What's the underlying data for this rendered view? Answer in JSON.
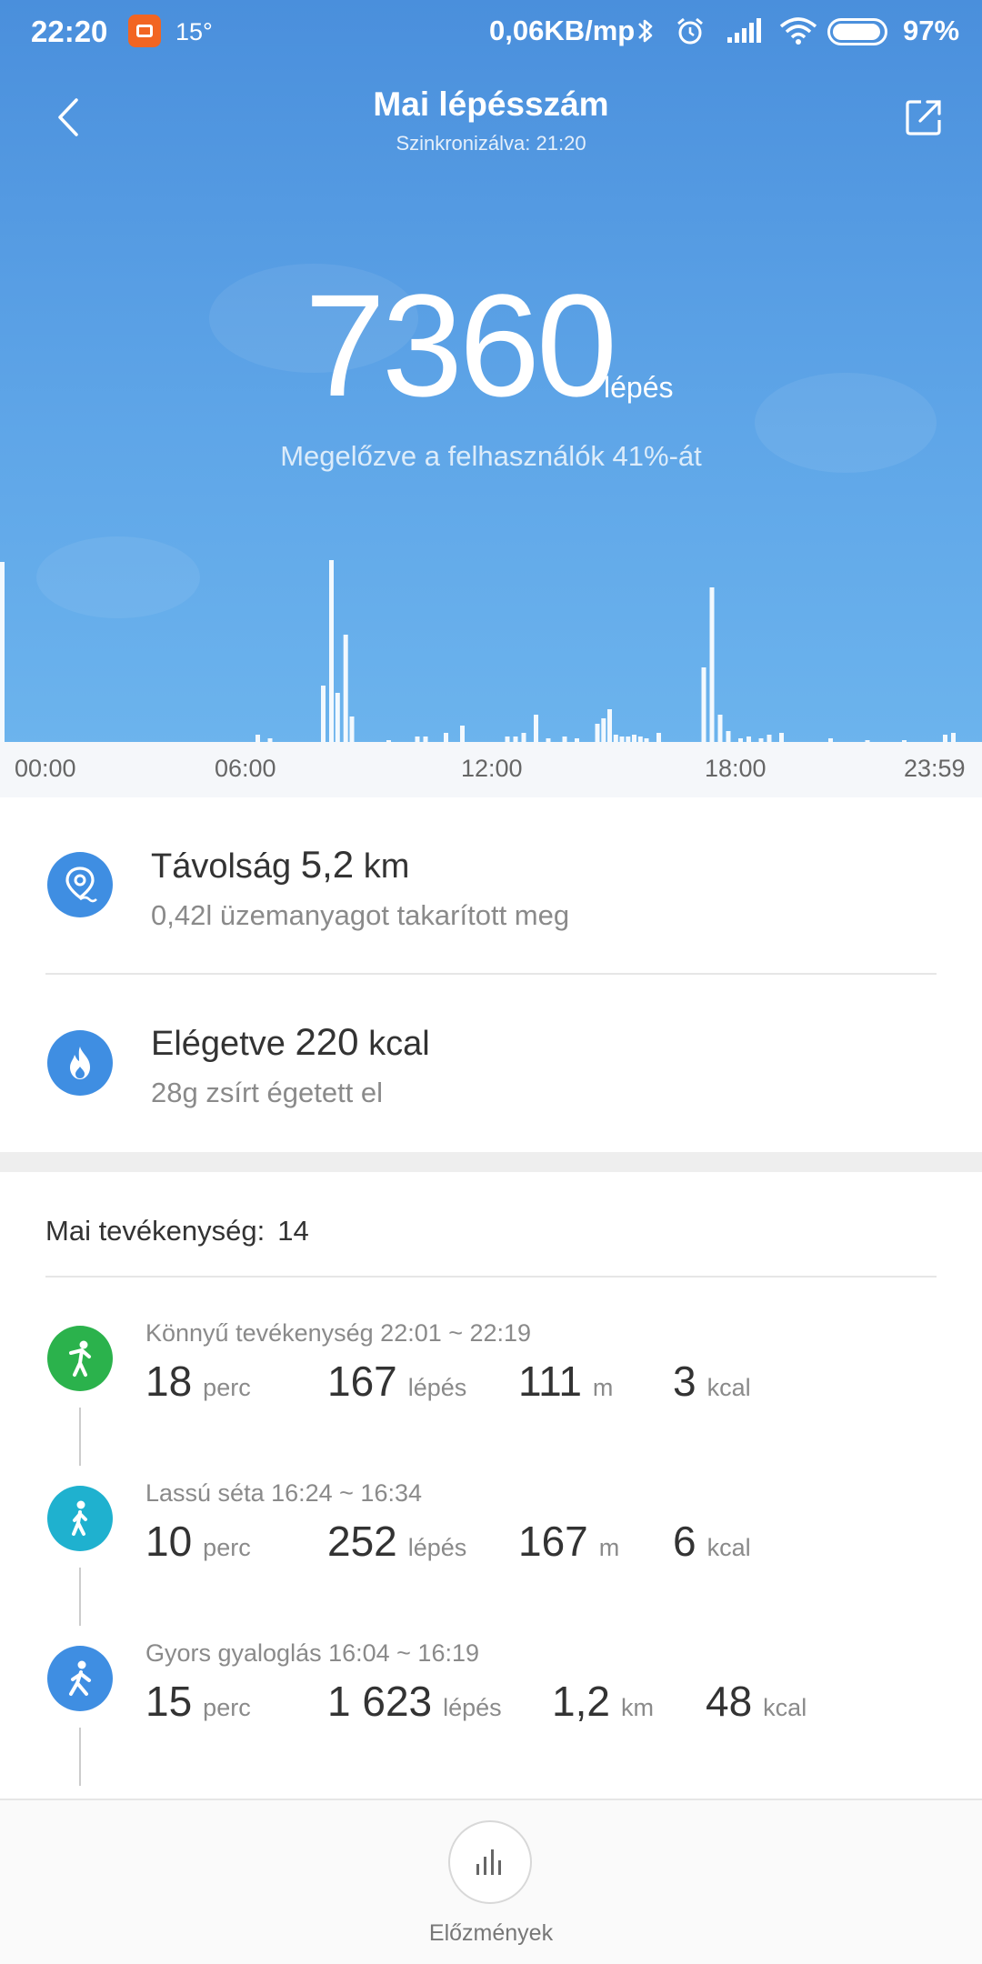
{
  "status_bar": {
    "time": "22:20",
    "temperature": "15°",
    "network_speed": "0,06KB/mp",
    "battery_percent": "97%",
    "icons": [
      "app-notification-icon",
      "bluetooth-icon",
      "alarm-icon",
      "signal-icon",
      "wifi-icon",
      "battery-icon"
    ]
  },
  "header": {
    "title": "Mai lépésszám",
    "subtitle": "Szinkronizálva: 21:20",
    "back_icon": "back-arrow-icon",
    "share_icon": "share-icon"
  },
  "steps": {
    "count": "7360",
    "unit": "lépés",
    "comparison": "Megelőzve a felhasználók 41%-át"
  },
  "chart_data": {
    "type": "bar",
    "title": "",
    "xlabel": "",
    "ylabel": "",
    "x_tick_labels": [
      "00:00",
      "06:00",
      "12:00",
      "18:00",
      "23:59"
    ],
    "x_range_hours": [
      0,
      24
    ],
    "grid": false,
    "bar_color": "#ffffff",
    "values_relative": [
      {
        "hour": 0.05,
        "value": 0.99
      },
      {
        "hour": 6.3,
        "value": 0.04
      },
      {
        "hour": 6.6,
        "value": 0.02
      },
      {
        "hour": 7.9,
        "value": 0.31
      },
      {
        "hour": 8.1,
        "value": 1.0
      },
      {
        "hour": 8.25,
        "value": 0.27
      },
      {
        "hour": 8.45,
        "value": 0.59
      },
      {
        "hour": 8.6,
        "value": 0.14
      },
      {
        "hour": 9.5,
        "value": 0.01
      },
      {
        "hour": 10.2,
        "value": 0.03
      },
      {
        "hour": 10.4,
        "value": 0.03
      },
      {
        "hour": 10.9,
        "value": 0.05
      },
      {
        "hour": 11.3,
        "value": 0.09
      },
      {
        "hour": 12.4,
        "value": 0.03
      },
      {
        "hour": 12.6,
        "value": 0.03
      },
      {
        "hour": 12.8,
        "value": 0.05
      },
      {
        "hour": 13.1,
        "value": 0.15
      },
      {
        "hour": 13.4,
        "value": 0.02
      },
      {
        "hour": 13.8,
        "value": 0.03
      },
      {
        "hour": 14.1,
        "value": 0.02
      },
      {
        "hour": 14.6,
        "value": 0.1
      },
      {
        "hour": 14.75,
        "value": 0.13
      },
      {
        "hour": 14.9,
        "value": 0.18
      },
      {
        "hour": 15.05,
        "value": 0.04
      },
      {
        "hour": 15.2,
        "value": 0.03
      },
      {
        "hour": 15.35,
        "value": 0.03
      },
      {
        "hour": 15.5,
        "value": 0.04
      },
      {
        "hour": 15.65,
        "value": 0.03
      },
      {
        "hour": 15.8,
        "value": 0.02
      },
      {
        "hour": 16.1,
        "value": 0.05
      },
      {
        "hour": 17.2,
        "value": 0.41
      },
      {
        "hour": 17.4,
        "value": 0.85
      },
      {
        "hour": 17.6,
        "value": 0.15
      },
      {
        "hour": 17.8,
        "value": 0.06
      },
      {
        "hour": 18.1,
        "value": 0.02
      },
      {
        "hour": 18.3,
        "value": 0.03
      },
      {
        "hour": 18.6,
        "value": 0.02
      },
      {
        "hour": 18.8,
        "value": 0.04
      },
      {
        "hour": 19.1,
        "value": 0.05
      },
      {
        "hour": 20.3,
        "value": 0.02
      },
      {
        "hour": 21.2,
        "value": 0.01
      },
      {
        "hour": 22.1,
        "value": 0.01
      },
      {
        "hour": 23.1,
        "value": 0.04
      },
      {
        "hour": 23.3,
        "value": 0.05
      }
    ]
  },
  "summary": {
    "distance": {
      "label": "Távolság",
      "value": "5,2",
      "unit": "km",
      "subtitle": "0,42l üzemanyagot takarított meg",
      "icon": "location-pin-icon"
    },
    "calories": {
      "label": "Elégetve",
      "value": "220",
      "unit": "kcal",
      "subtitle": "28g zsírt égetett el",
      "icon": "flame-icon"
    }
  },
  "activities": {
    "heading": "Mai tevékenység:",
    "count": "14",
    "items": [
      {
        "title": "Könnyű tevékenység 22:01 ~ 22:19",
        "icon": "light-activity-icon",
        "color": "#2bb24c",
        "stats": [
          {
            "num": "18",
            "unit": "perc"
          },
          {
            "num": "167",
            "unit": "lépés"
          },
          {
            "num": "111",
            "unit": "m"
          },
          {
            "num": "3",
            "unit": "kcal"
          }
        ]
      },
      {
        "title": "Lassú séta 16:24 ~ 16:34",
        "icon": "slow-walk-icon",
        "color": "#1fb1cf",
        "stats": [
          {
            "num": "10",
            "unit": "perc"
          },
          {
            "num": "252",
            "unit": "lépés"
          },
          {
            "num": "167",
            "unit": "m"
          },
          {
            "num": "6",
            "unit": "kcal"
          }
        ]
      },
      {
        "title": "Gyors gyaloglás 16:04 ~ 16:19",
        "icon": "fast-walk-icon",
        "color": "#3f8ee2",
        "stats": [
          {
            "num": "15",
            "unit": "perc"
          },
          {
            "num": "1 623",
            "unit": "lépés"
          },
          {
            "num": "1,2",
            "unit": "km"
          },
          {
            "num": "48",
            "unit": "kcal"
          }
        ]
      }
    ]
  },
  "bottom_bar": {
    "history_label": "Előzmények",
    "history_icon": "history-chart-icon"
  }
}
